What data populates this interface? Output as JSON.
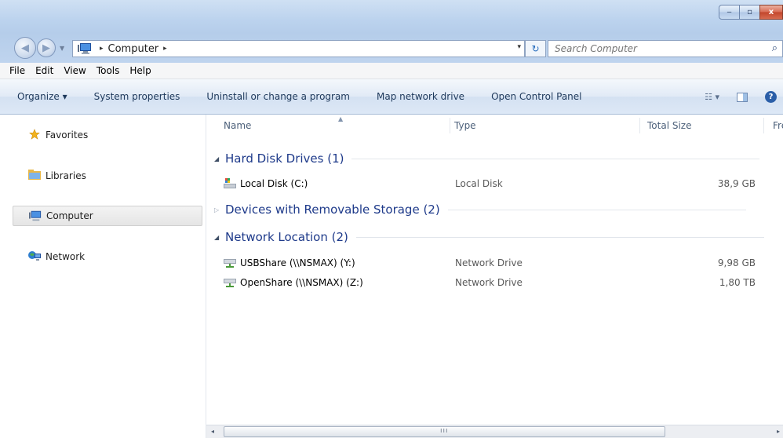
{
  "window": {
    "controls": {
      "minimize": "‒",
      "maximize": "▫",
      "close": "x"
    }
  },
  "address_bar": {
    "crumb_separator": "▸",
    "path": [
      "Computer"
    ],
    "dropdown": "▾",
    "refresh": "↻"
  },
  "search": {
    "placeholder": "Search Computer",
    "icon": "search-icon"
  },
  "menu": {
    "items": [
      "File",
      "Edit",
      "View",
      "Tools",
      "Help"
    ]
  },
  "command_bar": {
    "organize": "Organize ▾",
    "system_properties": "System properties",
    "uninstall": "Uninstall or change a program",
    "map_drive": "Map network drive",
    "control_panel": "Open Control Panel",
    "views": "☷ ▾",
    "help": "?"
  },
  "nav_pane": {
    "items": [
      {
        "label": "Favorites",
        "icon": "star-icon"
      },
      {
        "label": "Libraries",
        "icon": "libraries-icon"
      },
      {
        "label": "Computer",
        "icon": "computer-icon",
        "selected": true
      },
      {
        "label": "Network",
        "icon": "network-icon"
      }
    ]
  },
  "columns": {
    "name": "Name",
    "type": "Type",
    "total_size": "Total Size",
    "free": "Fre"
  },
  "groups": [
    {
      "title": "Hard Disk Drives (1)",
      "expanded": true,
      "items": [
        {
          "name": "Local Disk (C:)",
          "type": "Local Disk",
          "size": "38,9 GB",
          "icon": "local-disk-icon"
        }
      ]
    },
    {
      "title": "Devices with Removable Storage (2)",
      "expanded": false,
      "items": []
    },
    {
      "title": "Network Location (2)",
      "expanded": true,
      "items": [
        {
          "name": "USBShare (\\\\NSMAX) (Y:)",
          "type": "Network Drive",
          "size": "9,98 GB",
          "icon": "network-drive-icon"
        },
        {
          "name": "OpenShare (\\\\NSMAX) (Z:)",
          "type": "Network Drive",
          "size": "1,80 TB",
          "icon": "network-drive-icon"
        }
      ]
    }
  ],
  "scrollbar": {
    "left": "◂",
    "right": "▸",
    "grip": "ııı"
  }
}
